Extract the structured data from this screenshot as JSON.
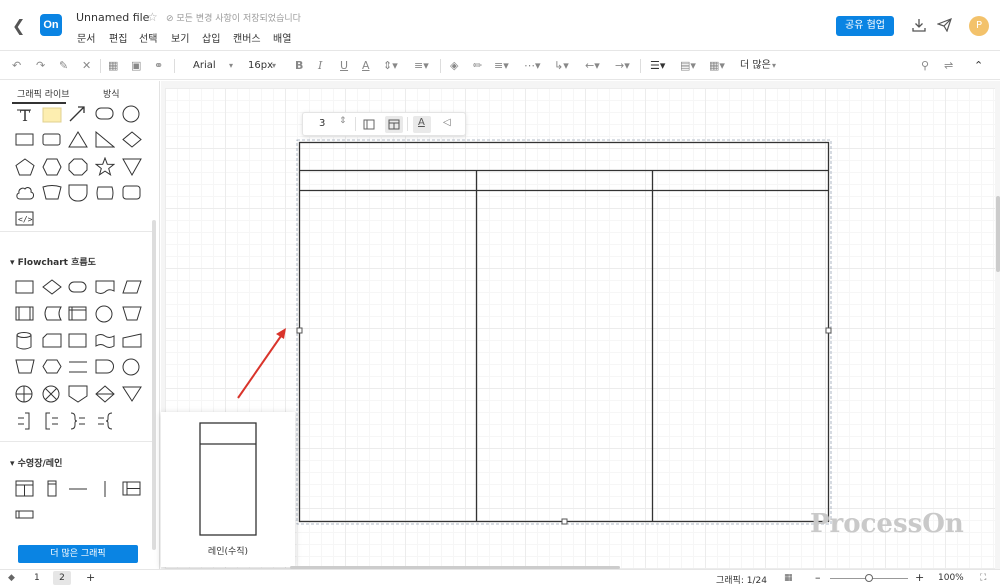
{
  "header": {
    "file_name": "Unnamed file",
    "save_status": "⊘ 모든 변경 사항이 저장되었습니다",
    "logo_text": "On",
    "menu": [
      "문서",
      "편집",
      "선택",
      "보기",
      "삽입",
      "캔버스",
      "배열"
    ],
    "share_label": "공유 협업",
    "avatar_initial": "P"
  },
  "toolbar": {
    "font_family": "Arial",
    "font_size": "16px",
    "more_label": "더 많은"
  },
  "sidebar": {
    "tabs": [
      "그래픽 라이브",
      "방식"
    ],
    "sections": [
      {
        "title": "Flowchart 흐름도"
      },
      {
        "title": "수영장/레인"
      }
    ],
    "more_shapes_label": "더 많은 그래픽"
  },
  "float_toolbar": {
    "count": "3"
  },
  "popup": {
    "label": "레인(수직)"
  },
  "watermark": "ProcessOn",
  "status": {
    "pages": [
      "1",
      "2"
    ],
    "shapes_count": "그래픽: 1/24",
    "zoom": "100%",
    "zoom_level": 0.5
  },
  "colors": {
    "accent": "#0a84e3",
    "arrow": "#d9342b",
    "avatar": "#f3c26b"
  }
}
